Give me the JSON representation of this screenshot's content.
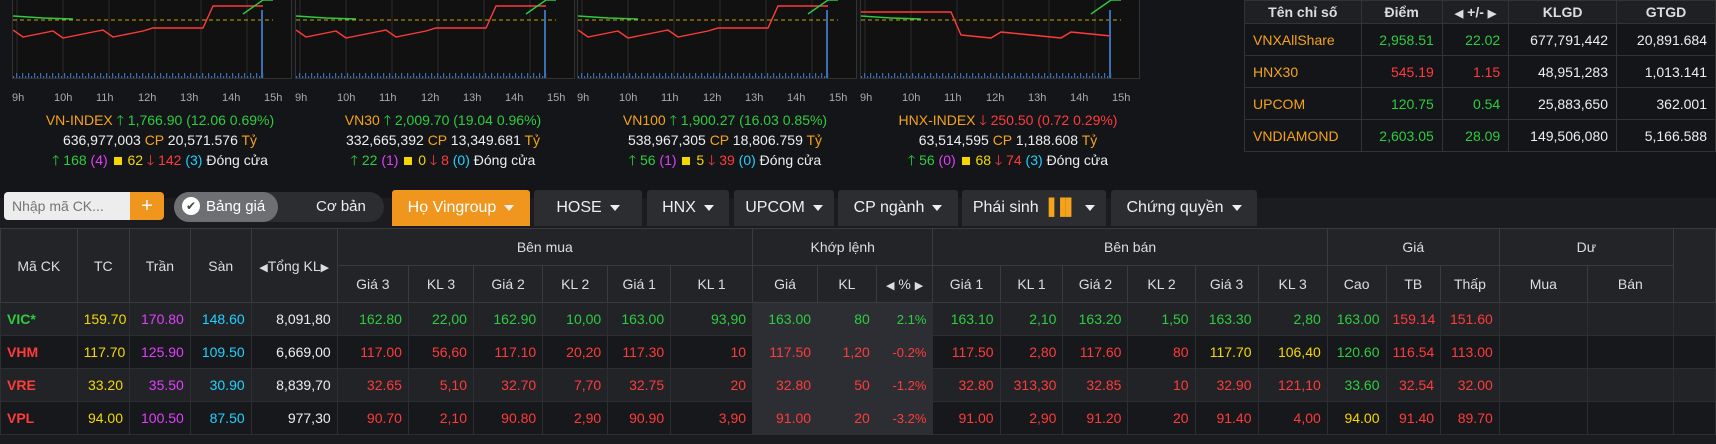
{
  "indices": [
    {
      "name": "VN-INDEX",
      "value": "1,766.90",
      "change": "12.06 0.69%",
      "dir": "up",
      "volume": "636,977,003",
      "cp": "CP",
      "gtgd": "20,571.576",
      "unit": "Tỷ",
      "up": "168",
      "ceil": "(4)",
      "ref": "62",
      "down": "142",
      "floor": "(3)",
      "status": "Đóng cửa"
    },
    {
      "name": "VN30",
      "value": "2,009.70",
      "change": "19.04 0.96%",
      "dir": "up",
      "volume": "332,665,392",
      "cp": "CP",
      "gtgd": "13,349.681",
      "unit": "Tỷ",
      "up": "22",
      "ceil": "(1)",
      "ref": "0",
      "down": "8",
      "floor": "(0)",
      "status": "Đóng cửa"
    },
    {
      "name": "VN100",
      "value": "1,900.27",
      "change": "16.03 0.85%",
      "dir": "up",
      "volume": "538,967,305",
      "cp": "CP",
      "gtgd": "18,806.759",
      "unit": "Tỷ",
      "up": "56",
      "ceil": "(1)",
      "ref": "5",
      "down": "39",
      "floor": "(0)",
      "status": "Đóng cửa"
    },
    {
      "name": "HNX-INDEX",
      "value": "250.50",
      "change": "0.72 0.29%",
      "dir": "down",
      "volume": "63,514,595",
      "cp": "CP",
      "gtgd": "1,188.608",
      "unit": "Tỷ",
      "up": "56",
      "ceil": "(0)",
      "ref": "68",
      "down": "74",
      "floor": "(3)",
      "status": "Đóng cửa"
    }
  ],
  "hours": [
    "9h",
    "10h",
    "11h",
    "12h",
    "13h",
    "14h",
    "15h"
  ],
  "summary": {
    "headers": [
      "Tên chỉ số",
      "Điểm",
      "+/-",
      "KLGD",
      "GTGD"
    ],
    "rows": [
      {
        "name": "VNXAllShare",
        "point": "2,958.51",
        "chg": "22.02",
        "klgd": "677,791,442",
        "gtgd": "20,891.684",
        "color": "#2ecc40"
      },
      {
        "name": "HNX30",
        "point": "545.19",
        "chg": "1.15",
        "klgd": "48,951,283",
        "gtgd": "1,013.141",
        "color": "#ff3b3b"
      },
      {
        "name": "UPCOM",
        "point": "120.75",
        "chg": "0.54",
        "klgd": "25,883,650",
        "gtgd": "362.001",
        "color": "#2ecc40"
      },
      {
        "name": "VNDIAMOND",
        "point": "2,603.05",
        "chg": "28.09",
        "klgd": "149,506,080",
        "gtgd": "5,166.588",
        "color": "#2ecc40"
      }
    ]
  },
  "toolbar": {
    "search_placeholder": "Nhập mã CK...",
    "plus": "+",
    "toggle_on": "Bảng giá",
    "toggle_off": "Cơ bản",
    "tabs": [
      "Họ Vingroup",
      "HOSE",
      "HNX",
      "UPCOM",
      "CP ngành",
      "Phái sinh",
      "Chứng quyền"
    ]
  },
  "board": {
    "h1": {
      "code": "Mã CK",
      "tc": "TC",
      "tran": "Trần",
      "san": "Sàn",
      "tongkl": "Tổng KL",
      "benmua": "Bên mua",
      "khop": "Khớp lệnh",
      "benban": "Bên bán",
      "gia": "Giá",
      "du": "Dư"
    },
    "h2": [
      "Giá 3",
      "KL 3",
      "Giá 2",
      "KL 2",
      "Giá 1",
      "KL 1",
      "Giá",
      "KL",
      "%",
      "Giá 1",
      "KL 1",
      "Giá 2",
      "KL 2",
      "Giá 3",
      "KL 3",
      "Cao",
      "TB",
      "Thấp",
      "Mua",
      "Bán"
    ],
    "rows": [
      {
        "code": "VIC*",
        "tc": "159.70",
        "tran": "170.80",
        "san": "148.60",
        "tongkl": "8,091,80",
        "b3": "162.80",
        "bk3": "22,00",
        "b2": "162.90",
        "bk2": "10,00",
        "b1": "163.00",
        "bk1": "93,90",
        "mp": "163.00",
        "mk": "80",
        "pct": "2.1%",
        "s1": "163.10",
        "sk1": "2,10",
        "s2": "163.20",
        "sk2": "1,50",
        "s3": "163.30",
        "sk3": "2,80",
        "hi": "163.00",
        "avg": "159.14",
        "lo": "151.60"
      },
      {
        "code": "VHM",
        "tc": "117.70",
        "tran": "125.90",
        "san": "109.50",
        "tongkl": "6,669,00",
        "b3": "117.00",
        "bk3": "56,60",
        "b2": "117.10",
        "bk2": "20,20",
        "b1": "117.30",
        "bk1": "10",
        "mp": "117.50",
        "mk": "1,20",
        "pct": "-0.2%",
        "s1": "117.50",
        "sk1": "2,80",
        "s2": "117.60",
        "sk2": "80",
        "s3": "117.70",
        "sk3": "106,40",
        "hi": "120.60",
        "avg": "116.54",
        "lo": "113.00"
      },
      {
        "code": "VRE",
        "tc": "33.20",
        "tran": "35.50",
        "san": "30.90",
        "tongkl": "8,839,70",
        "b3": "32.65",
        "bk3": "5,10",
        "b2": "32.70",
        "bk2": "7,70",
        "b1": "32.75",
        "bk1": "20",
        "mp": "32.80",
        "mk": "50",
        "pct": "-1.2%",
        "s1": "32.80",
        "sk1": "313,30",
        "s2": "32.85",
        "sk2": "10",
        "s3": "32.90",
        "sk3": "121,10",
        "hi": "33.60",
        "avg": "32.54",
        "lo": "32.00"
      },
      {
        "code": "VPL",
        "tc": "94.00",
        "tran": "100.50",
        "san": "87.50",
        "tongkl": "977,30",
        "b3": "90.70",
        "bk3": "2,10",
        "b2": "90.80",
        "bk2": "2,90",
        "b1": "90.90",
        "bk1": "3,90",
        "mp": "91.00",
        "mk": "20",
        "pct": "-3.2%",
        "s1": "91.00",
        "sk1": "2,90",
        "s2": "91.20",
        "sk2": "20",
        "s3": "91.40",
        "sk3": "4,00",
        "hi": "94.00",
        "avg": "91.40",
        "lo": "89.70"
      }
    ],
    "colors": {
      "VIC*": {
        "code": "#2ecc40",
        "b3": "#2ecc40",
        "b2": "#2ecc40",
        "b1": "#2ecc40",
        "mp": "#2ecc40",
        "s1": "#2ecc40",
        "s2": "#2ecc40",
        "s3": "#2ecc40",
        "hi": "#2ecc40",
        "avg": "#ff3b3b",
        "lo": "#ff3b3b"
      },
      "VHM": {
        "code": "#ff3b3b",
        "b3": "#ff3b3b",
        "b2": "#ff3b3b",
        "b1": "#ff3b3b",
        "mp": "#ff3b3b",
        "s1": "#ff3b3b",
        "s2": "#ff3b3b",
        "s3": "#f5d800",
        "hi": "#2ecc40",
        "avg": "#ff3b3b",
        "lo": "#ff3b3b"
      },
      "VRE": {
        "code": "#ff3b3b",
        "b3": "#ff3b3b",
        "b2": "#ff3b3b",
        "b1": "#ff3b3b",
        "mp": "#ff3b3b",
        "s1": "#ff3b3b",
        "s2": "#ff3b3b",
        "s3": "#ff3b3b",
        "hi": "#2ecc40",
        "avg": "#ff3b3b",
        "lo": "#ff3b3b"
      },
      "VPL": {
        "code": "#ff3b3b",
        "b3": "#ff3b3b",
        "b2": "#ff3b3b",
        "b1": "#ff3b3b",
        "mp": "#ff3b3b",
        "s1": "#ff3b3b",
        "s2": "#ff3b3b",
        "s3": "#ff3b3b",
        "hi": "#f5d800",
        "avg": "#ff3b3b",
        "lo": "#ff3b3b"
      }
    }
  }
}
